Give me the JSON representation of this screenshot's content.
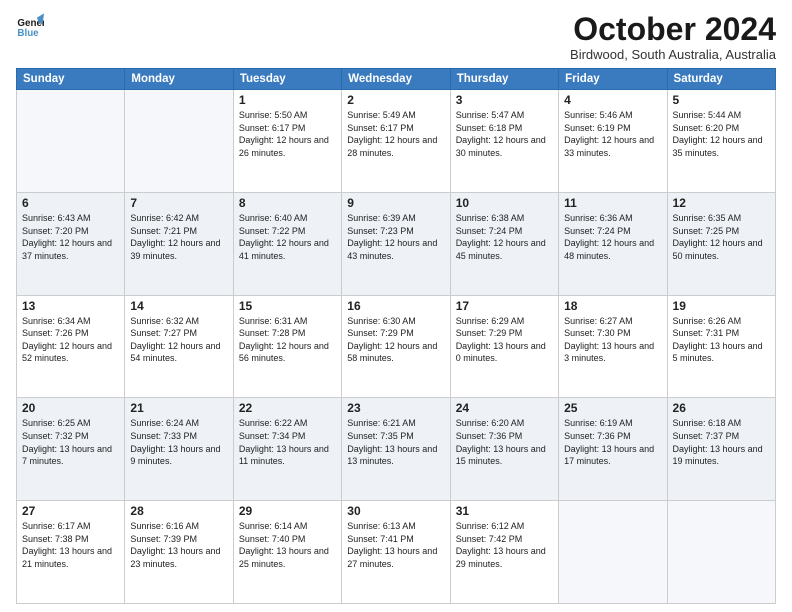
{
  "header": {
    "logo_line1": "General",
    "logo_line2": "Blue",
    "month": "October 2024",
    "location": "Birdwood, South Australia, Australia"
  },
  "days_of_week": [
    "Sunday",
    "Monday",
    "Tuesday",
    "Wednesday",
    "Thursday",
    "Friday",
    "Saturday"
  ],
  "weeks": [
    [
      {
        "day": "",
        "sunrise": "",
        "sunset": "",
        "daylight": ""
      },
      {
        "day": "",
        "sunrise": "",
        "sunset": "",
        "daylight": ""
      },
      {
        "day": "1",
        "sunrise": "Sunrise: 5:50 AM",
        "sunset": "Sunset: 6:17 PM",
        "daylight": "Daylight: 12 hours and 26 minutes."
      },
      {
        "day": "2",
        "sunrise": "Sunrise: 5:49 AM",
        "sunset": "Sunset: 6:17 PM",
        "daylight": "Daylight: 12 hours and 28 minutes."
      },
      {
        "day": "3",
        "sunrise": "Sunrise: 5:47 AM",
        "sunset": "Sunset: 6:18 PM",
        "daylight": "Daylight: 12 hours and 30 minutes."
      },
      {
        "day": "4",
        "sunrise": "Sunrise: 5:46 AM",
        "sunset": "Sunset: 6:19 PM",
        "daylight": "Daylight: 12 hours and 33 minutes."
      },
      {
        "day": "5",
        "sunrise": "Sunrise: 5:44 AM",
        "sunset": "Sunset: 6:20 PM",
        "daylight": "Daylight: 12 hours and 35 minutes."
      }
    ],
    [
      {
        "day": "6",
        "sunrise": "Sunrise: 6:43 AM",
        "sunset": "Sunset: 7:20 PM",
        "daylight": "Daylight: 12 hours and 37 minutes."
      },
      {
        "day": "7",
        "sunrise": "Sunrise: 6:42 AM",
        "sunset": "Sunset: 7:21 PM",
        "daylight": "Daylight: 12 hours and 39 minutes."
      },
      {
        "day": "8",
        "sunrise": "Sunrise: 6:40 AM",
        "sunset": "Sunset: 7:22 PM",
        "daylight": "Daylight: 12 hours and 41 minutes."
      },
      {
        "day": "9",
        "sunrise": "Sunrise: 6:39 AM",
        "sunset": "Sunset: 7:23 PM",
        "daylight": "Daylight: 12 hours and 43 minutes."
      },
      {
        "day": "10",
        "sunrise": "Sunrise: 6:38 AM",
        "sunset": "Sunset: 7:24 PM",
        "daylight": "Daylight: 12 hours and 45 minutes."
      },
      {
        "day": "11",
        "sunrise": "Sunrise: 6:36 AM",
        "sunset": "Sunset: 7:24 PM",
        "daylight": "Daylight: 12 hours and 48 minutes."
      },
      {
        "day": "12",
        "sunrise": "Sunrise: 6:35 AM",
        "sunset": "Sunset: 7:25 PM",
        "daylight": "Daylight: 12 hours and 50 minutes."
      }
    ],
    [
      {
        "day": "13",
        "sunrise": "Sunrise: 6:34 AM",
        "sunset": "Sunset: 7:26 PM",
        "daylight": "Daylight: 12 hours and 52 minutes."
      },
      {
        "day": "14",
        "sunrise": "Sunrise: 6:32 AM",
        "sunset": "Sunset: 7:27 PM",
        "daylight": "Daylight: 12 hours and 54 minutes."
      },
      {
        "day": "15",
        "sunrise": "Sunrise: 6:31 AM",
        "sunset": "Sunset: 7:28 PM",
        "daylight": "Daylight: 12 hours and 56 minutes."
      },
      {
        "day": "16",
        "sunrise": "Sunrise: 6:30 AM",
        "sunset": "Sunset: 7:29 PM",
        "daylight": "Daylight: 12 hours and 58 minutes."
      },
      {
        "day": "17",
        "sunrise": "Sunrise: 6:29 AM",
        "sunset": "Sunset: 7:29 PM",
        "daylight": "Daylight: 13 hours and 0 minutes."
      },
      {
        "day": "18",
        "sunrise": "Sunrise: 6:27 AM",
        "sunset": "Sunset: 7:30 PM",
        "daylight": "Daylight: 13 hours and 3 minutes."
      },
      {
        "day": "19",
        "sunrise": "Sunrise: 6:26 AM",
        "sunset": "Sunset: 7:31 PM",
        "daylight": "Daylight: 13 hours and 5 minutes."
      }
    ],
    [
      {
        "day": "20",
        "sunrise": "Sunrise: 6:25 AM",
        "sunset": "Sunset: 7:32 PM",
        "daylight": "Daylight: 13 hours and 7 minutes."
      },
      {
        "day": "21",
        "sunrise": "Sunrise: 6:24 AM",
        "sunset": "Sunset: 7:33 PM",
        "daylight": "Daylight: 13 hours and 9 minutes."
      },
      {
        "day": "22",
        "sunrise": "Sunrise: 6:22 AM",
        "sunset": "Sunset: 7:34 PM",
        "daylight": "Daylight: 13 hours and 11 minutes."
      },
      {
        "day": "23",
        "sunrise": "Sunrise: 6:21 AM",
        "sunset": "Sunset: 7:35 PM",
        "daylight": "Daylight: 13 hours and 13 minutes."
      },
      {
        "day": "24",
        "sunrise": "Sunrise: 6:20 AM",
        "sunset": "Sunset: 7:36 PM",
        "daylight": "Daylight: 13 hours and 15 minutes."
      },
      {
        "day": "25",
        "sunrise": "Sunrise: 6:19 AM",
        "sunset": "Sunset: 7:36 PM",
        "daylight": "Daylight: 13 hours and 17 minutes."
      },
      {
        "day": "26",
        "sunrise": "Sunrise: 6:18 AM",
        "sunset": "Sunset: 7:37 PM",
        "daylight": "Daylight: 13 hours and 19 minutes."
      }
    ],
    [
      {
        "day": "27",
        "sunrise": "Sunrise: 6:17 AM",
        "sunset": "Sunset: 7:38 PM",
        "daylight": "Daylight: 13 hours and 21 minutes."
      },
      {
        "day": "28",
        "sunrise": "Sunrise: 6:16 AM",
        "sunset": "Sunset: 7:39 PM",
        "daylight": "Daylight: 13 hours and 23 minutes."
      },
      {
        "day": "29",
        "sunrise": "Sunrise: 6:14 AM",
        "sunset": "Sunset: 7:40 PM",
        "daylight": "Daylight: 13 hours and 25 minutes."
      },
      {
        "day": "30",
        "sunrise": "Sunrise: 6:13 AM",
        "sunset": "Sunset: 7:41 PM",
        "daylight": "Daylight: 13 hours and 27 minutes."
      },
      {
        "day": "31",
        "sunrise": "Sunrise: 6:12 AM",
        "sunset": "Sunset: 7:42 PM",
        "daylight": "Daylight: 13 hours and 29 minutes."
      },
      {
        "day": "",
        "sunrise": "",
        "sunset": "",
        "daylight": ""
      },
      {
        "day": "",
        "sunrise": "",
        "sunset": "",
        "daylight": ""
      }
    ]
  ]
}
